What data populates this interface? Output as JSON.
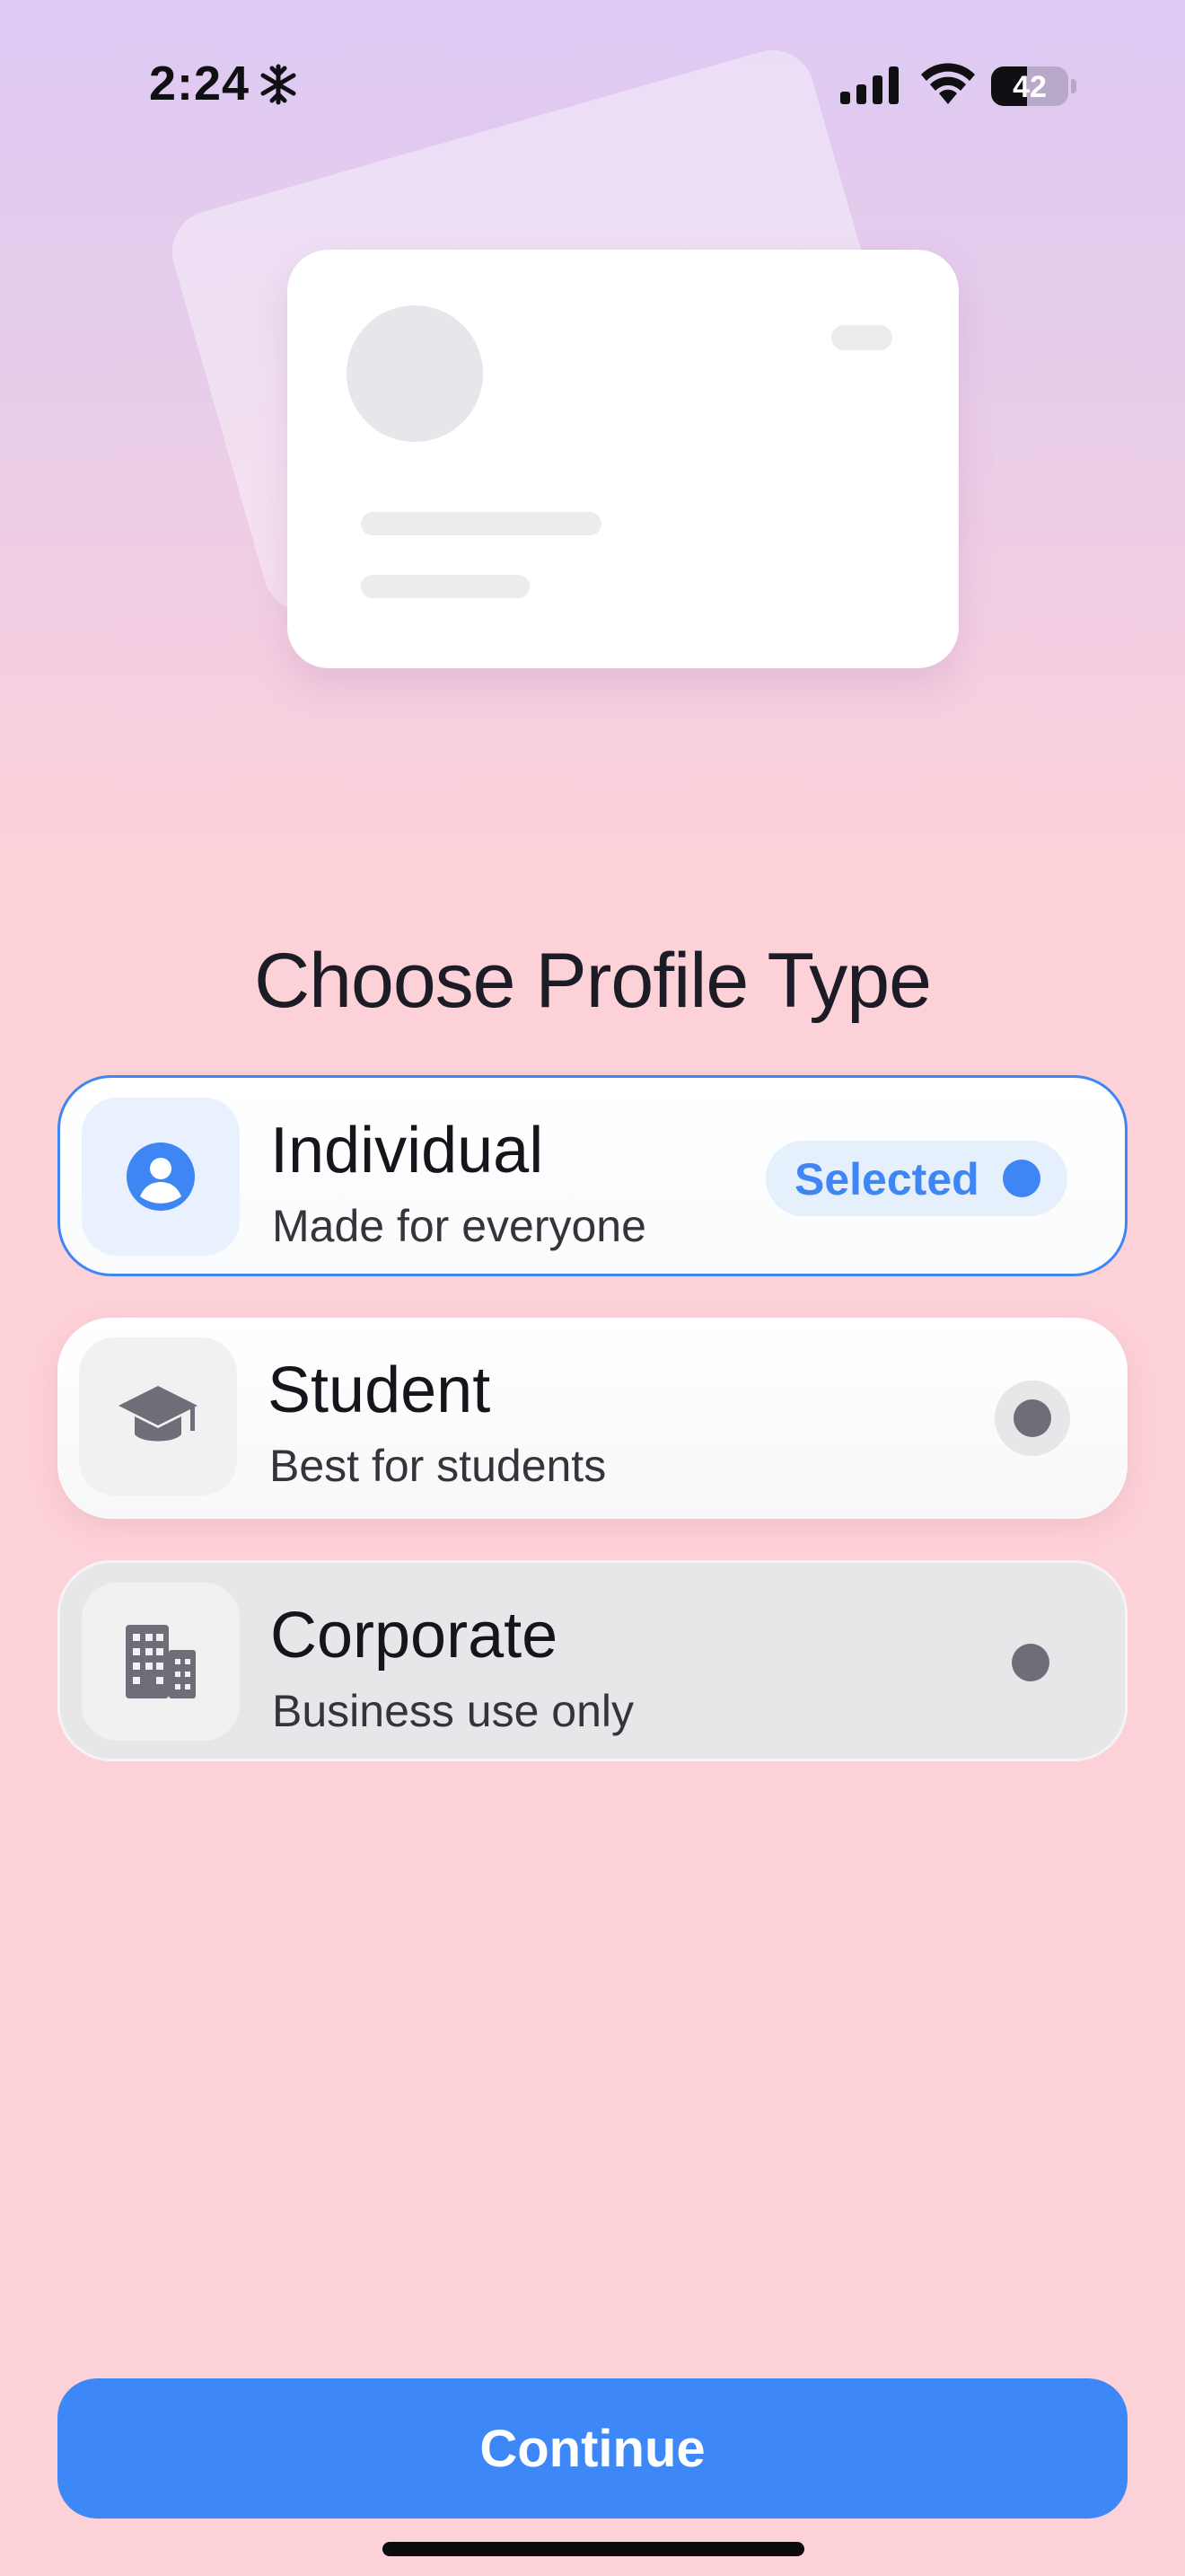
{
  "status_bar": {
    "time": "2:24",
    "time_icon": "snowflake-icon",
    "battery": "42",
    "icons": [
      "cellular-signal-icon",
      "wifi-icon",
      "battery-icon"
    ]
  },
  "title": "Choose Profile Type",
  "options": [
    {
      "name": "Individual",
      "description": "Made for everyone",
      "icon": "person-circle-icon",
      "state_label": "Selected",
      "selected": true
    },
    {
      "name": "Student",
      "description": "Best for students",
      "icon": "graduation-cap-icon",
      "selected": false
    },
    {
      "name": "Corporate",
      "description": "Business use only",
      "icon": "building-icon",
      "selected": false
    }
  ],
  "continue_label": "Continue",
  "colors": {
    "accent": "#3d87f7",
    "background": "#fdd1d8",
    "hero_top": "#ddc9f3"
  }
}
